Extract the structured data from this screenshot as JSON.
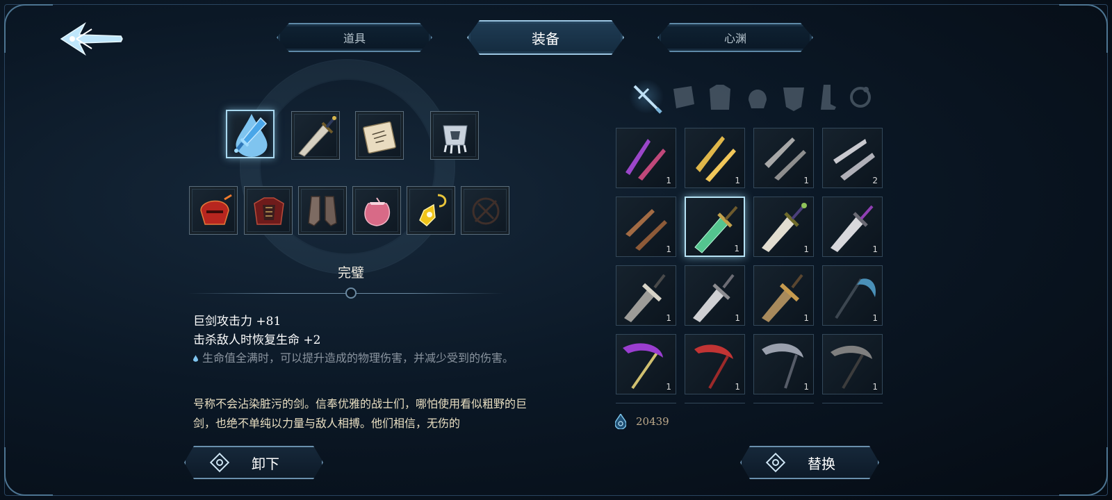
{
  "tabs": [
    {
      "label": "道具",
      "active": false
    },
    {
      "label": "装备",
      "active": true
    },
    {
      "label": "心渊",
      "active": false
    }
  ],
  "equipped_slots": {
    "row1": [
      {
        "icon": "greatsword-blue-icon",
        "selected": true
      },
      {
        "icon": "greatsword-icon",
        "selected": false
      },
      {
        "icon": "scroll-icon",
        "selected": false
      },
      {
        "icon": "cloth-charm-icon",
        "selected": false
      }
    ],
    "row2": [
      {
        "icon": "red-helmet-icon"
      },
      {
        "icon": "red-armor-icon"
      },
      {
        "icon": "boots-icon"
      },
      {
        "icon": "pink-pouch-icon"
      },
      {
        "icon": "gold-charm-icon"
      },
      {
        "icon": "empty-slot-icon"
      }
    ]
  },
  "item": {
    "name": "完璧",
    "stats": [
      "巨剑攻击力 +81",
      "击杀敌人时恢复生命 +2"
    ],
    "passive": "生命值全满时，可以提升造成的物理伤害，并减少受到的伤害。",
    "lore": "号称不会沾染脏污的剑。信奉优雅的战士们，哪怕使用看似粗野的巨剑，也绝不单纯以力量与敌人相搏。他们相信，无伤的"
  },
  "buttons": {
    "unequip": "卸下",
    "replace": "替换"
  },
  "categories": [
    "sword-icon",
    "gauntlet-icon",
    "armor-icon",
    "helmet-icon",
    "chestplate-icon",
    "boots-icon",
    "ring-icon"
  ],
  "inventory": [
    {
      "icon": "purple-twin-blades-icon",
      "count": "1"
    },
    {
      "icon": "gold-twin-blades-icon",
      "count": "1"
    },
    {
      "icon": "silver-twin-blades-icon",
      "count": "1"
    },
    {
      "icon": "steel-twin-blades-icon",
      "count": "2"
    },
    {
      "icon": "bronze-twin-blades-icon",
      "count": "1"
    },
    {
      "icon": "green-greatsword-icon",
      "count": "1",
      "selected": true
    },
    {
      "icon": "jade-greatsword-icon",
      "count": "1"
    },
    {
      "icon": "violet-greatsword-icon",
      "count": "1"
    },
    {
      "icon": "dark-greatsword-icon",
      "count": "1"
    },
    {
      "icon": "silver-greatsword-icon",
      "count": "1"
    },
    {
      "icon": "bronze-greatsword-icon",
      "count": "1"
    },
    {
      "icon": "frost-scythe-icon",
      "count": "1"
    },
    {
      "icon": "purple-scythe-icon",
      "count": "1"
    },
    {
      "icon": "crimson-scythe-icon",
      "count": "1"
    },
    {
      "icon": "iron-scythe-icon",
      "count": "1"
    },
    {
      "icon": "shadow-scythe-icon",
      "count": "1"
    }
  ],
  "currency": {
    "icon": "soul-drop-icon",
    "amount": "20439"
  }
}
